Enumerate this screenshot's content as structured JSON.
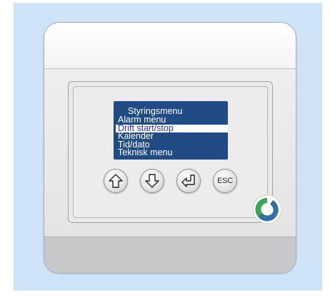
{
  "screen": {
    "title": "Styringsmenu",
    "menu_items": [
      {
        "label": "Alarm menu",
        "selected": false
      },
      {
        "label": "Drift start/stop",
        "selected": true
      },
      {
        "label": "Kalender",
        "selected": false
      },
      {
        "label": "Tid/dato",
        "selected": false
      },
      {
        "label": "Teknisk menu",
        "selected": false
      }
    ]
  },
  "buttons": {
    "up": {
      "icon": "arrow-up-icon"
    },
    "down": {
      "icon": "arrow-down-icon"
    },
    "enter": {
      "icon": "enter-return-icon"
    },
    "esc": {
      "label": "ESC"
    }
  },
  "logo": {
    "icon": "brand-logo-icon"
  },
  "colors": {
    "backdrop": "#cfe3f7",
    "screen_background": "#204b85",
    "screen_text": "#ffffff",
    "selection_background": "#ffffff",
    "selection_text": "#2b2bc8",
    "logo_green": "#3aa655",
    "logo_blue": "#2f6fa8"
  }
}
